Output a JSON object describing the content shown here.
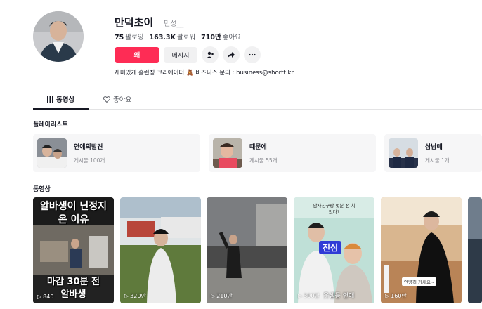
{
  "profile": {
    "name": "만덕초이",
    "handle": "민성__",
    "stats": {
      "following_value": "75",
      "following_label": "팔로잉",
      "followers_value": "163.3K",
      "followers_label": "팔로워",
      "likes_value": "710만",
      "likes_label": "좋아요"
    },
    "follow_label": "왜",
    "message_label": "메시지",
    "bio": "재미있게 홀런칭 크리에이터 🧸 비즈니스 문의 : business@shortt.kr"
  },
  "tabs": [
    {
      "label": "동영상",
      "icon": "grid-icon",
      "active": true
    },
    {
      "label": "좋아요",
      "icon": "heart-outline-icon",
      "active": false
    }
  ],
  "sections": {
    "playlists_title": "플레이리스트",
    "videos_title": "동영상"
  },
  "playlists": [
    {
      "title": "연애의발견",
      "count": "게시물 100개"
    },
    {
      "title": "때문에",
      "count": "게시물 55개"
    },
    {
      "title": "삼남매",
      "count": "게시물 1개"
    }
  ],
  "videos": [
    {
      "views": "840",
      "caption_top": "알바생이 닌정지\n온 이유",
      "caption_bottom": "마감 30분 전\n알바생"
    },
    {
      "views": "320만"
    },
    {
      "views": "210만"
    },
    {
      "views": "390만",
      "caption_top": "남자친구랑 몇분 전 치\n있다?",
      "caption_mid": "진심",
      "caption_bottom": "옷샘등 연애"
    },
    {
      "views": "160만",
      "caption_mini": "안녕히 가세요~"
    },
    {
      "views": ""
    }
  ],
  "colors": {
    "accent": "#fe2c55",
    "text": "#161823",
    "muted": "#8a8b91",
    "button_bg": "#f1f1f2"
  }
}
